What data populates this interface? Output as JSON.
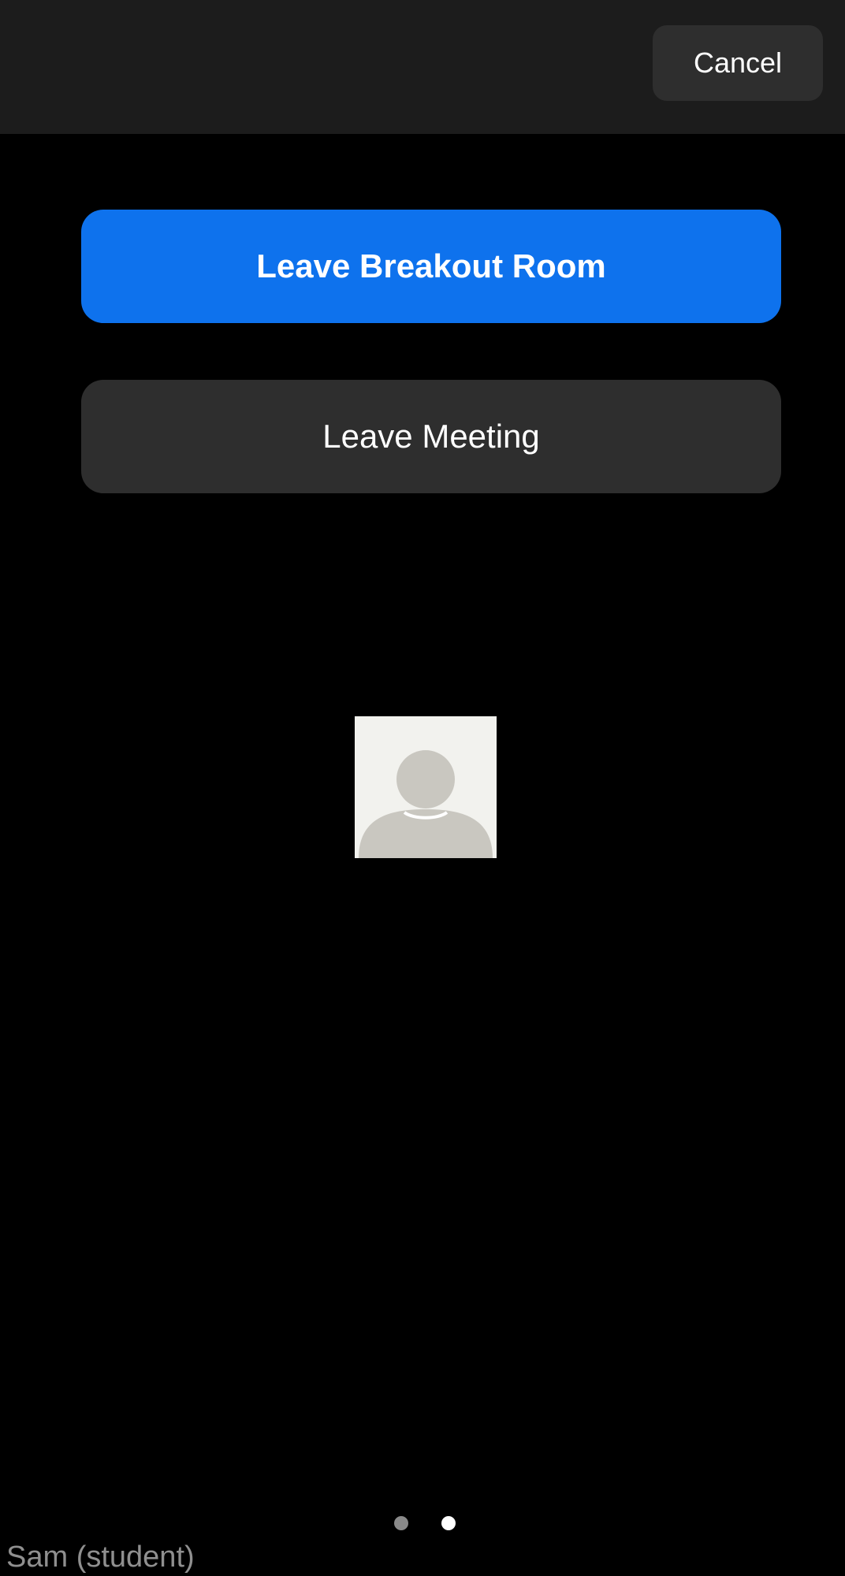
{
  "header": {
    "cancel_label": "Cancel"
  },
  "actions": {
    "leave_breakout_label": "Leave Breakout Room",
    "leave_meeting_label": "Leave Meeting"
  },
  "video_tile": {
    "avatar_icon": "default-user-avatar-icon",
    "participant_name": "Sam (student)"
  },
  "pagination": {
    "page_count": 2,
    "current_page": 2
  },
  "colors": {
    "accent": "#0e72ed",
    "background": "#000000",
    "header_background": "#1c1c1c",
    "secondary_button": "#2e2e2e"
  }
}
